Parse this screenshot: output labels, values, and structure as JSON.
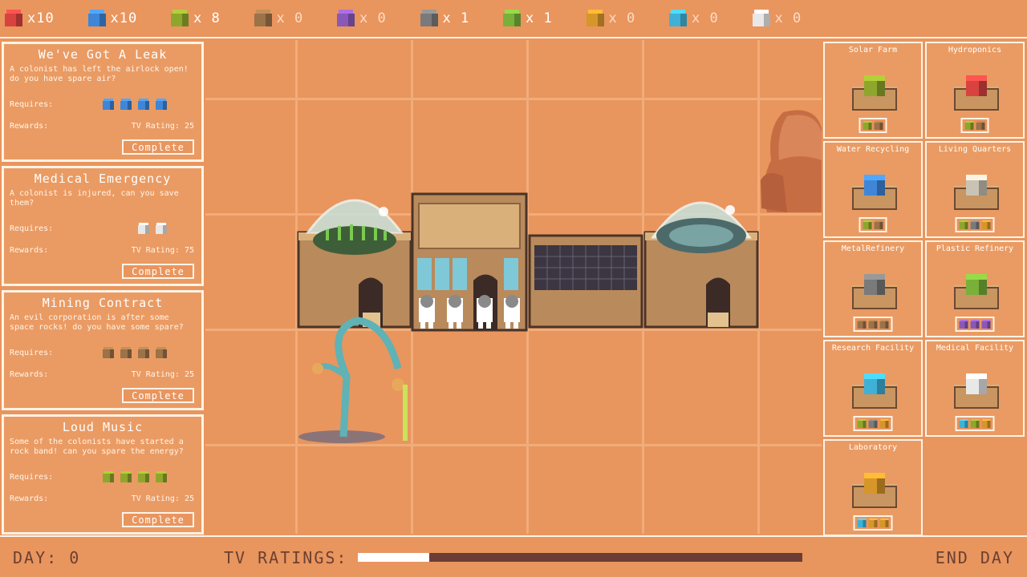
{
  "resources": [
    {
      "name": "red-cube",
      "color": "#d8433f",
      "count": "x10"
    },
    {
      "name": "blue-cube",
      "color": "#3f86d8",
      "count": "x10"
    },
    {
      "name": "green-cube",
      "color": "#8fa62d",
      "count": "x 8"
    },
    {
      "name": "brown-cube",
      "color": "#9c7248",
      "count": "x 0"
    },
    {
      "name": "purple-cube",
      "color": "#8a58b8",
      "count": "x 0"
    },
    {
      "name": "grey-cube",
      "color": "#7a7a7a",
      "count": "x 1"
    },
    {
      "name": "lime-cube",
      "color": "#78b03a",
      "count": "x 1"
    },
    {
      "name": "orange-cube",
      "color": "#d7962a",
      "count": "x 0"
    },
    {
      "name": "cyan-cube",
      "color": "#3fb1d8",
      "count": "x 0"
    },
    {
      "name": "medical-cube",
      "color": "#e8e8e8",
      "count": "x 0"
    }
  ],
  "missions": [
    {
      "title": "We've Got A Leak",
      "desc": "A colonist has left the airlock open! do you have spare air?",
      "requires_label": "Requires:",
      "rewards_label": "Rewards:",
      "reward": "TV Rating: 25",
      "req_icons": [
        "#3f86d8",
        "#3f86d8",
        "#3f86d8",
        "#3f86d8"
      ],
      "button": "Complete"
    },
    {
      "title": "Medical Emergency",
      "desc": "A colonist is injured, can you save them?",
      "requires_label": "Requires:",
      "rewards_label": "Rewards:",
      "reward": "TV Rating: 75",
      "req_icons": [
        "#e8e8e8",
        "#e8e8e8"
      ],
      "button": "Complete"
    },
    {
      "title": "Mining Contract",
      "desc": "An evil corporation is after some space rocks! do you have some spare?",
      "requires_label": "Requires:",
      "rewards_label": "Rewards:",
      "reward": "TV Rating: 25",
      "req_icons": [
        "#9c7248",
        "#9c7248",
        "#9c7248",
        "#9c7248"
      ],
      "button": "Complete"
    },
    {
      "title": "Loud Music",
      "desc": "Some of the colonists have started a rock band! can you spare the energy?",
      "requires_label": "Requires:",
      "rewards_label": "Rewards:",
      "reward": "TV Rating: 25",
      "req_icons": [
        "#8fa62d",
        "#8fa62d",
        "#8fa62d",
        "#8fa62d"
      ],
      "button": "Complete"
    }
  ],
  "buildings": [
    {
      "name": "Solar Farm",
      "cube": "#8fa62d",
      "cost": [
        "#8fa62d",
        "#9c7248"
      ]
    },
    {
      "name": "Hydroponics",
      "cube": "#d8433f",
      "cost": [
        "#8fa62d",
        "#9c7248"
      ]
    },
    {
      "name": "Water Recycling",
      "cube": "#3f86d8",
      "cost": [
        "#8fa62d",
        "#9c7248"
      ]
    },
    {
      "name": "Living Quarters",
      "cube": "#c9c3b5",
      "cost": [
        "#8fa62d",
        "#7a7a7a",
        "#d7962a"
      ]
    },
    {
      "name": "MetalRefinery",
      "cube": "#7a7a7a",
      "cost": [
        "#9c7248",
        "#9c7248",
        "#9c7248"
      ]
    },
    {
      "name": "Plastic Refinery",
      "cube": "#78b03a",
      "cost": [
        "#8a58b8",
        "#8a58b8",
        "#8a58b8"
      ]
    },
    {
      "name": "Research Facility",
      "cube": "#3fb1d8",
      "cost": [
        "#8fa62d",
        "#7a7a7a",
        "#d7962a"
      ]
    },
    {
      "name": "Medical Facility",
      "cube": "#e8e8e8",
      "cost": [
        "#3fb1d8",
        "#8fa62d",
        "#d7962a"
      ]
    },
    {
      "name": "Laboratory",
      "cube": "#d7962a",
      "cost": [
        "#3fb1d8",
        "#d7962a",
        "#d7962a"
      ]
    }
  ],
  "bottom": {
    "day": "DAY: 0",
    "tv_label": "TV RATINGS:",
    "tv_rating_fraction": 0.16,
    "end_day": "END DAY"
  }
}
